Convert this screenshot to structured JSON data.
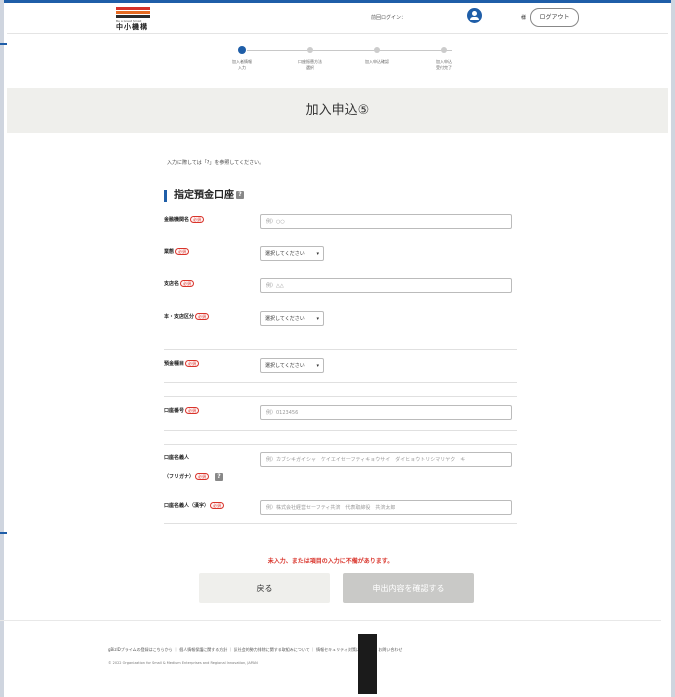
{
  "header": {
    "logo_small": "Be a Great Small",
    "logo_name": "中小機構",
    "last_login": "前回ログイン：",
    "user_suffix": "様",
    "logout_label": "ログアウト"
  },
  "steps": [
    {
      "label": "加入者情報\n入力",
      "active": true
    },
    {
      "label": "口座振替方法\n選択",
      "active": false
    },
    {
      "label": "加入申込確認",
      "active": false
    },
    {
      "label": "加入申込\n受付完了",
      "active": false
    }
  ],
  "page_title": "加入申込⑤",
  "note": "入力に際しては「?」を参照してください。",
  "section": {
    "title": "指定預金口座",
    "help": "?"
  },
  "required_badge": "必須",
  "fields": {
    "bank_name": {
      "label": "金融機関名",
      "placeholder": "例）○○"
    },
    "business_type": {
      "label": "業態",
      "value": "選択してください"
    },
    "branch_name": {
      "label": "支店名",
      "placeholder": "例）△△"
    },
    "branch_class": {
      "label": "本・支店区分",
      "value": "選択してください"
    },
    "deposit_type": {
      "label": "預金種目",
      "value": "選択してください"
    },
    "account_number": {
      "label": "口座番号",
      "placeholder": "例）0123456"
    },
    "account_holder_kana": {
      "label": "口座名義人",
      "label2": "（フリガナ）",
      "placeholder": "例）カブシキガイシャ　ケイエイセーフティキョウサイ　ダイヒョウトリシマリヤク　キ"
    },
    "account_holder_kanji": {
      "label": "口座名義人（漢字）",
      "placeholder": "例）株式会社経営セーフティ共済　代表取締役　共済太郎"
    }
  },
  "error_message": "未入力、または項目の入力に不備があります。",
  "buttons": {
    "back": "戻る",
    "confirm": "申出内容を確認する"
  },
  "footer": {
    "links": "gBizIDプライムの登録はこちらから ｜ 個人情報保護に関する方針 ｜ 反社会的勢力排除に関する取組みについて ｜ 情報セキュリティ対策について ｜ お問い合わせ",
    "copyright": "© 2022 Organization for Small & Medium Enterprises and Regional Innovation, JAPAN"
  }
}
